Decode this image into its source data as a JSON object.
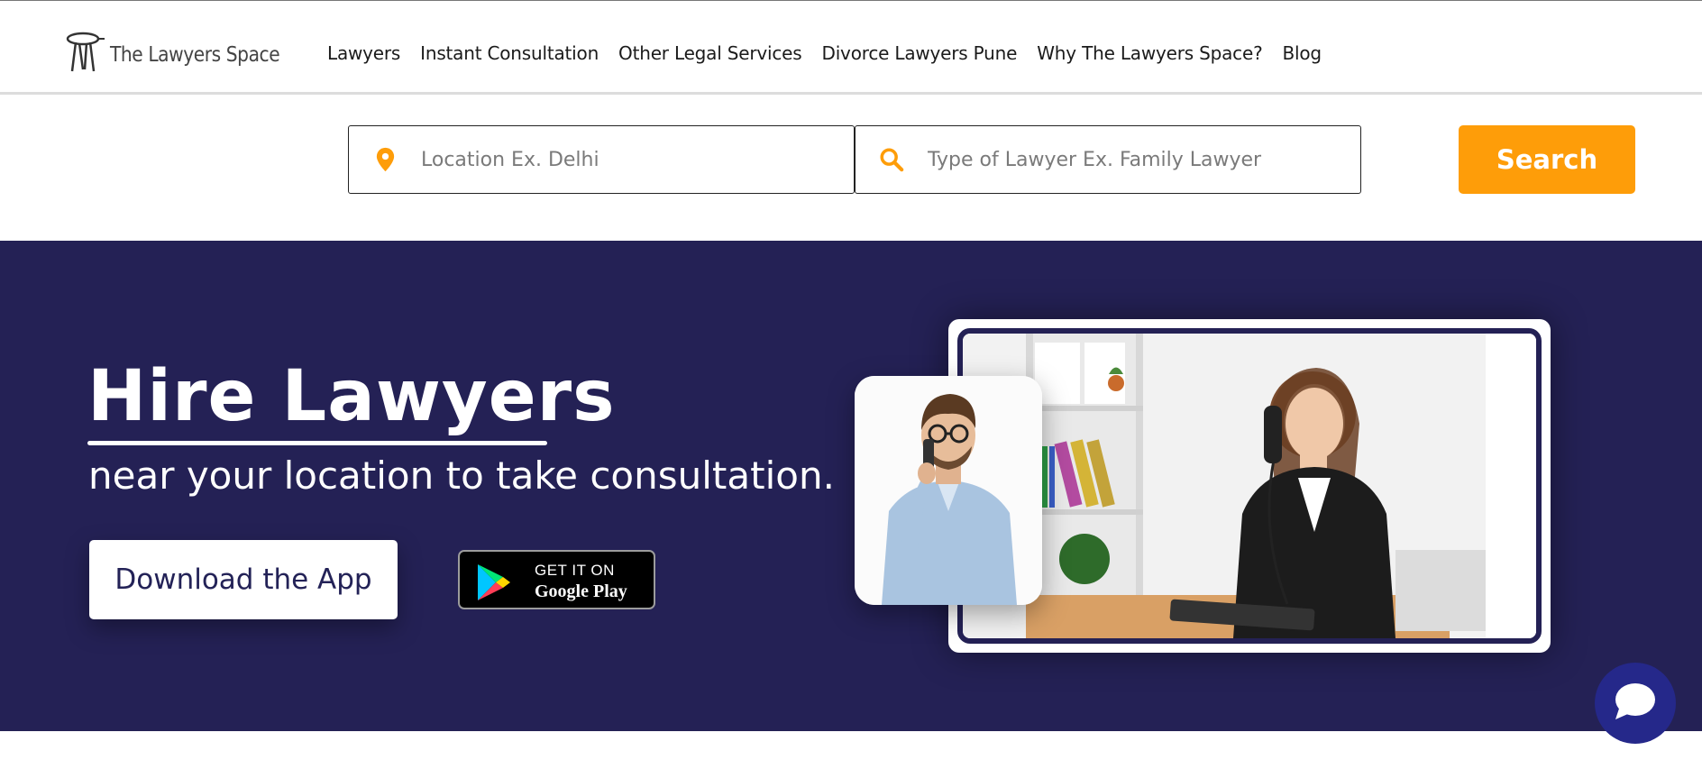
{
  "header": {
    "logo_text": "The Lawyers Space",
    "nav": [
      {
        "label": "Lawyers"
      },
      {
        "label": "Instant Consultation"
      },
      {
        "label": "Other Legal Services"
      },
      {
        "label": "Divorce Lawyers Pune"
      },
      {
        "label": "Why The Lawyers Space?"
      },
      {
        "label": "Blog"
      }
    ]
  },
  "search": {
    "location_placeholder": "Location Ex. Delhi",
    "type_placeholder": "Type of Lawyer Ex. Family Lawyer",
    "button_label": "Search",
    "location_icon": "map-pin-icon",
    "type_icon": "search-icon"
  },
  "hero": {
    "title": "Hire Lawyers",
    "subtitle": "near your location to take consultation.",
    "download_label": "Download the App",
    "google_play": {
      "top": "GET IT ON",
      "bottom": "Google Play"
    }
  },
  "chat": {
    "icon": "chat-bubble-icon"
  },
  "colors": {
    "accent": "#fe9d09",
    "hero_bg": "#242155",
    "chat_bg": "#25288a"
  }
}
